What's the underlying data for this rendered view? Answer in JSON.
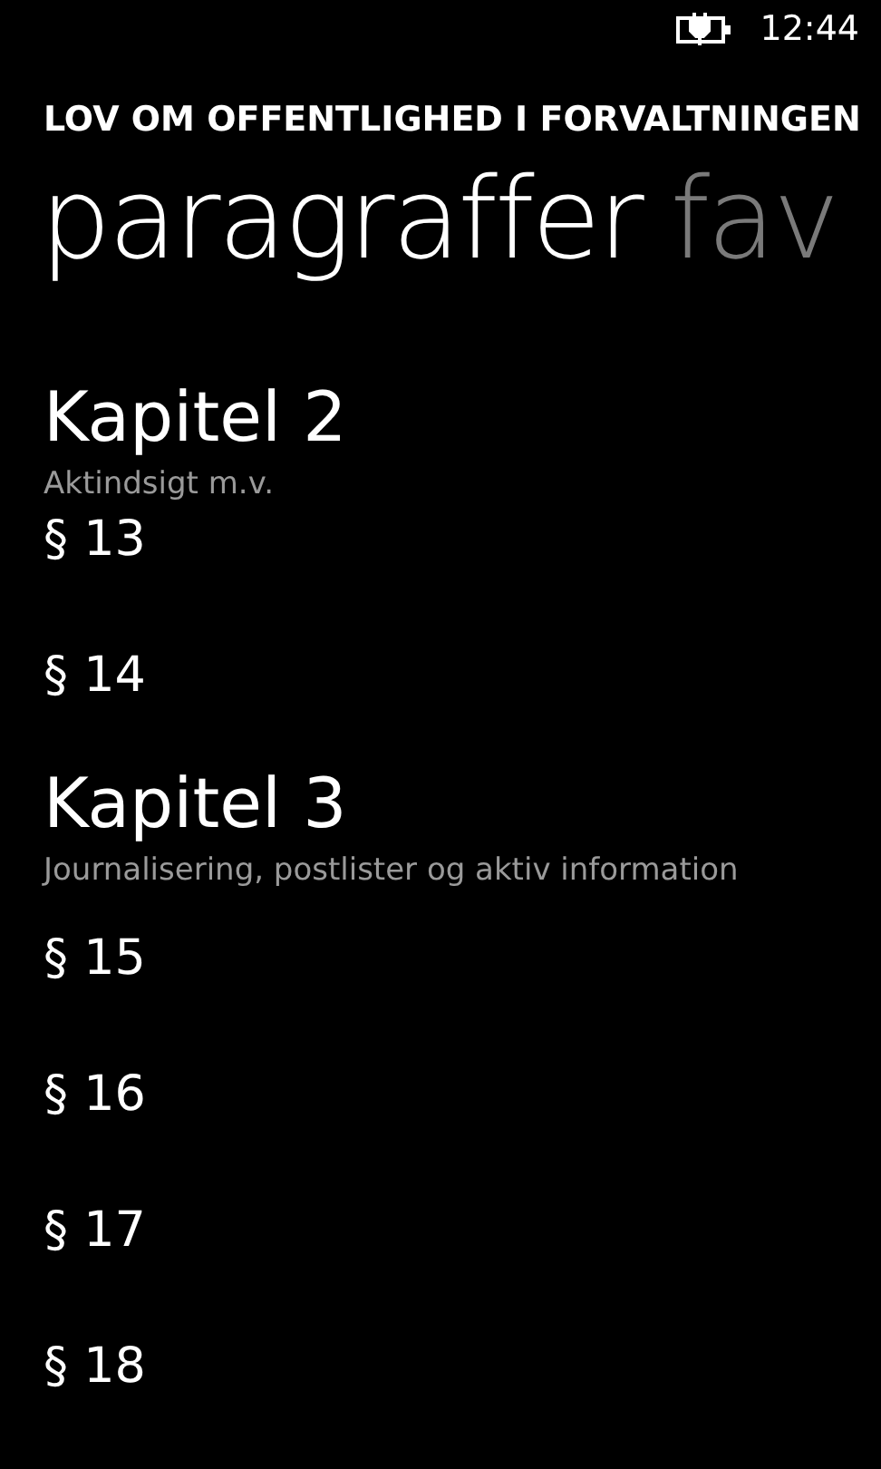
{
  "status_bar": {
    "time": "12:44"
  },
  "app_title": "LOV OM OFFENTLIGHED I FORVALTNINGEN",
  "pivot": [
    {
      "label": "paragraffer",
      "selected": true
    },
    {
      "label": "fav",
      "selected": false
    }
  ],
  "chapters": [
    {
      "title": "Kapitel 2",
      "subtitle": "Aktindsigt m.v.",
      "items": [
        {
          "label": "§ 13"
        },
        {
          "label": "§ 14"
        }
      ]
    },
    {
      "title": "Kapitel 3",
      "subtitle": "Journalisering, postlister og aktiv information",
      "items": [
        {
          "label": "§ 15"
        },
        {
          "label": "§ 16"
        },
        {
          "label": "§ 17"
        },
        {
          "label": "§ 18"
        }
      ]
    }
  ]
}
